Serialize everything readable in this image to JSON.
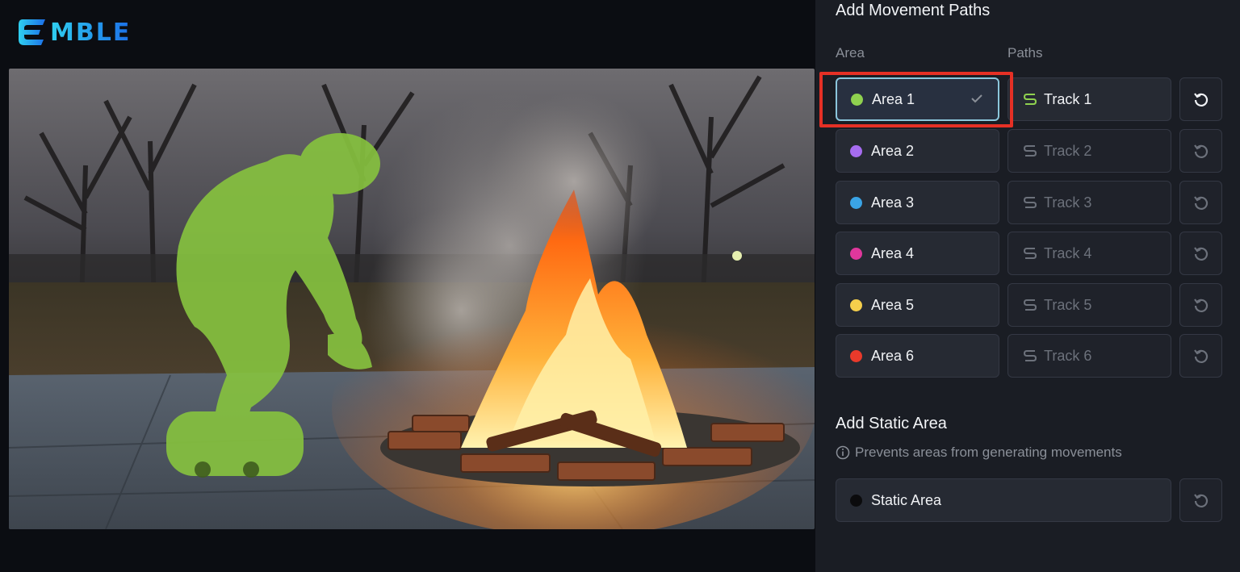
{
  "logo": {
    "text": "MBLE"
  },
  "panel": {
    "movement_title": "Add Movement Paths",
    "area_label": "Area",
    "paths_label": "Paths",
    "rows": [
      {
        "area": "Area 1",
        "color": "#8fd14f",
        "track": "Track 1",
        "selected": true
      },
      {
        "area": "Area 2",
        "color": "#a66cf0",
        "track": "Track 2",
        "selected": false
      },
      {
        "area": "Area 3",
        "color": "#3aa4e6",
        "track": "Track 3",
        "selected": false
      },
      {
        "area": "Area 4",
        "color": "#e0379c",
        "track": "Track 4",
        "selected": false
      },
      {
        "area": "Area 5",
        "color": "#f5cf4c",
        "track": "Track 5",
        "selected": false
      },
      {
        "area": "Area 6",
        "color": "#e93a2b",
        "track": "Track 6",
        "selected": false
      }
    ],
    "static_title": "Add Static Area",
    "static_hint": "Prevents areas from generating movements",
    "static_area": {
      "label": "Static Area",
      "color": "#0b0b0d"
    }
  },
  "colors": {
    "track_active": "#8fd14f",
    "highlight": "#e53025"
  }
}
